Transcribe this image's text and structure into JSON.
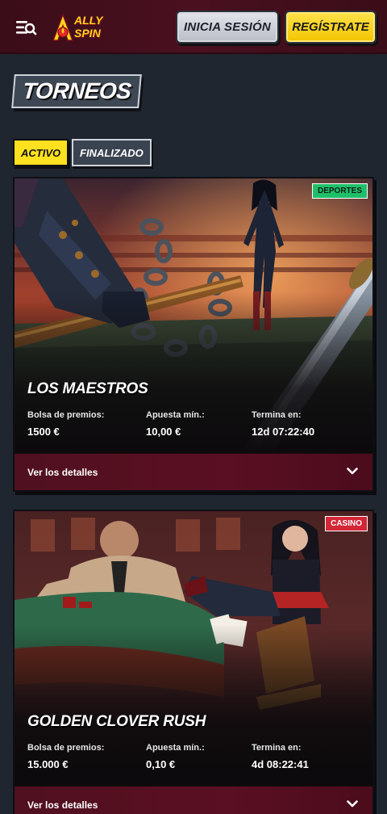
{
  "header": {
    "logo": {
      "line1": "ALLY",
      "line2": "SPIN"
    },
    "login_label": "INICIA SESIÓN",
    "register_label": "REGÍSTRATE",
    "menu_icon": "menu-search-icon"
  },
  "page": {
    "title": "TORNEOS"
  },
  "tabs": [
    {
      "label": "ACTIVO",
      "active": true
    },
    {
      "label": "FINALIZADO",
      "active": false
    }
  ],
  "tournaments": [
    {
      "badge": "DEPORTES",
      "title": "LOS MAESTROS",
      "stats": [
        {
          "label": "Bolsa de premios:",
          "value": "1500 €"
        },
        {
          "label": "Apuesta mín.:",
          "value": "10,00 €"
        },
        {
          "label": "Termina en:",
          "value": "12d 07:22:40"
        }
      ],
      "details_label": "Ver los detalles"
    },
    {
      "badge": "CASINO",
      "title": "GOLDEN CLOVER RUSH",
      "stats": [
        {
          "label": "Bolsa de premios:",
          "value": "15.000 €"
        },
        {
          "label": "Apuesta mín.:",
          "value": "0,10 €"
        },
        {
          "label": "Termina en:",
          "value": "4d 08:22:41"
        }
      ],
      "details_label": "Ver los detalles"
    }
  ],
  "colors": {
    "background": "#1f2630",
    "header": "#4a1020",
    "accent_yellow": "#ffe11f",
    "details_bar": "#5a0f22",
    "sports_badge": "#1fbf6a",
    "casino_badge": "#d32636"
  }
}
